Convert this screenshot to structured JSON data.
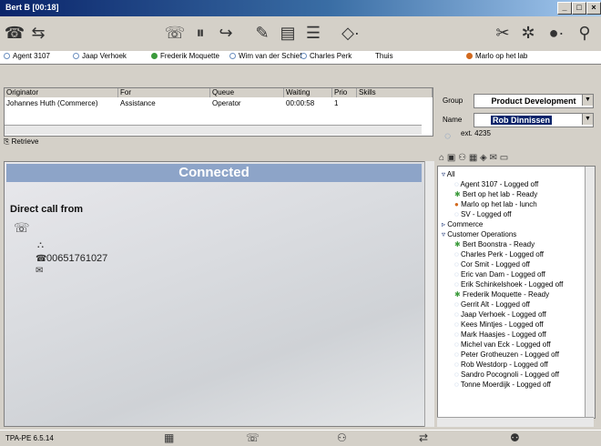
{
  "window": {
    "title": "Bert B [00:18]"
  },
  "agents_bar": [
    {
      "name": "Agent 3107",
      "status": "off"
    },
    {
      "name": "Jaap Verhoek",
      "status": "off"
    },
    {
      "name": "Frederik Moquette",
      "status": "ready"
    },
    {
      "name": "Wim van der Schief",
      "status": "off"
    },
    {
      "name": "Charles Perk",
      "status": "off"
    },
    {
      "name": "Thuis",
      "status": "none"
    },
    {
      "name": "Marlo op het lab",
      "status": "lunch"
    }
  ],
  "queue": {
    "headers": [
      "Originator",
      "For",
      "Queue",
      "Waiting",
      "Prio",
      "Skills"
    ],
    "row": [
      "Johannes Huth (Commerce)",
      "Assistance",
      "Operator",
      "00:00:58",
      "1",
      ""
    ],
    "retrieve_label": "Retrieve"
  },
  "call": {
    "status": "Connected",
    "direct_label": "Direct call from",
    "phone": "00651761027"
  },
  "contact": {
    "group_label": "Group",
    "group_value": "Product Development",
    "name_label": "Name",
    "name_value": "Rob Dinnissen",
    "ext": "ext. 4235"
  },
  "tree": [
    {
      "text": "All",
      "level": 0,
      "status": "folder"
    },
    {
      "text": "Agent 3107 - Logged off",
      "level": 1,
      "status": "off"
    },
    {
      "text": "Bert op het lab - Ready",
      "level": 1,
      "status": "ready"
    },
    {
      "text": "Marlo op het lab - lunch",
      "level": 1,
      "status": "lunch"
    },
    {
      "text": "SV - Logged off",
      "level": 1,
      "status": "off"
    },
    {
      "text": "Commerce",
      "level": 0,
      "status": "folder-closed"
    },
    {
      "text": "Customer Operations",
      "level": 0,
      "status": "folder"
    },
    {
      "text": "Bert Boonstra - Ready",
      "level": 1,
      "status": "ready"
    },
    {
      "text": "Charles Perk - Logged off",
      "level": 1,
      "status": "off"
    },
    {
      "text": "Cor Smit - Logged off",
      "level": 1,
      "status": "off"
    },
    {
      "text": "Eric van Dam - Logged off",
      "level": 1,
      "status": "off"
    },
    {
      "text": "Erik Schinkelshoek - Logged off",
      "level": 1,
      "status": "off"
    },
    {
      "text": "Frederik Moquette - Ready",
      "level": 1,
      "status": "ready"
    },
    {
      "text": "Gerrit Alt - Logged off",
      "level": 1,
      "status": "off"
    },
    {
      "text": "Jaap Verhoek - Logged off",
      "level": 1,
      "status": "off"
    },
    {
      "text": "Kees Mintjes - Logged off",
      "level": 1,
      "status": "off"
    },
    {
      "text": "Mark Haasjes - Logged off",
      "level": 1,
      "status": "off"
    },
    {
      "text": "Michel van Eck - Logged off",
      "level": 1,
      "status": "off"
    },
    {
      "text": "Peter Grotheuzen - Logged off",
      "level": 1,
      "status": "off"
    },
    {
      "text": "Rob Westdorp - Logged off",
      "level": 1,
      "status": "off"
    },
    {
      "text": "Sandro Pocognoli - Logged off",
      "level": 1,
      "status": "off"
    },
    {
      "text": "Tonne Moerdijk - Logged off",
      "level": 1,
      "status": "off"
    }
  ],
  "statusbar": {
    "text": "TPA-PE 6.5.14"
  },
  "colors": {
    "ready": "#3b9a3b",
    "lunch": "#d2691e",
    "off": "#6b8fbf",
    "connected_bar": "#8da4c8"
  }
}
